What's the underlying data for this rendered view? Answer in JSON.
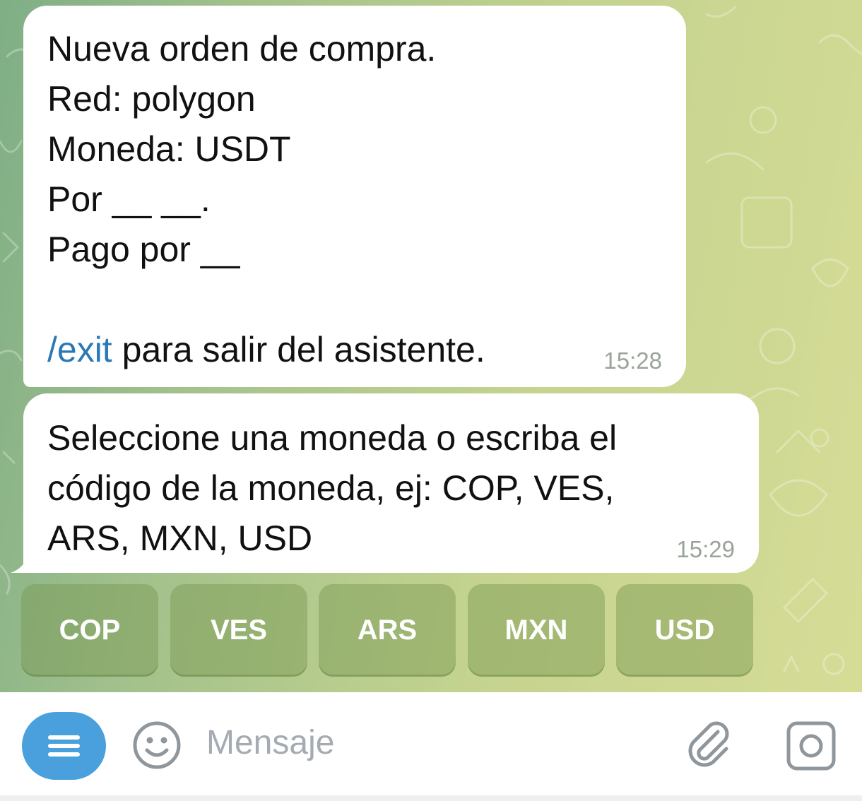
{
  "chat": {
    "messages": [
      {
        "lines": [
          "Nueva orden de compra.",
          "Red: polygon",
          "Moneda: USDT",
          "Por __ __.",
          "Pago por __"
        ],
        "command": "/exit",
        "command_suffix": " para salir del asistente.",
        "time": "15:28"
      },
      {
        "lines": [
          "Seleccione una moneda o escriba el",
          "código de la moneda, ej: COP, VES,",
          "ARS, MXN, USD"
        ],
        "time": "15:29"
      }
    ]
  },
  "keyboard": {
    "buttons": [
      "COP",
      "VES",
      "ARS",
      "MXN",
      "USD"
    ]
  },
  "input": {
    "placeholder": "Mensaje",
    "icons": [
      "menu-icon",
      "emoji-icon",
      "attach-icon",
      "camera-icon"
    ]
  },
  "colors": {
    "accent": "#4aa0dc",
    "command_link": "#2b78b7",
    "chat_background": "#b8cd8e",
    "bubble": "#ffffff"
  }
}
